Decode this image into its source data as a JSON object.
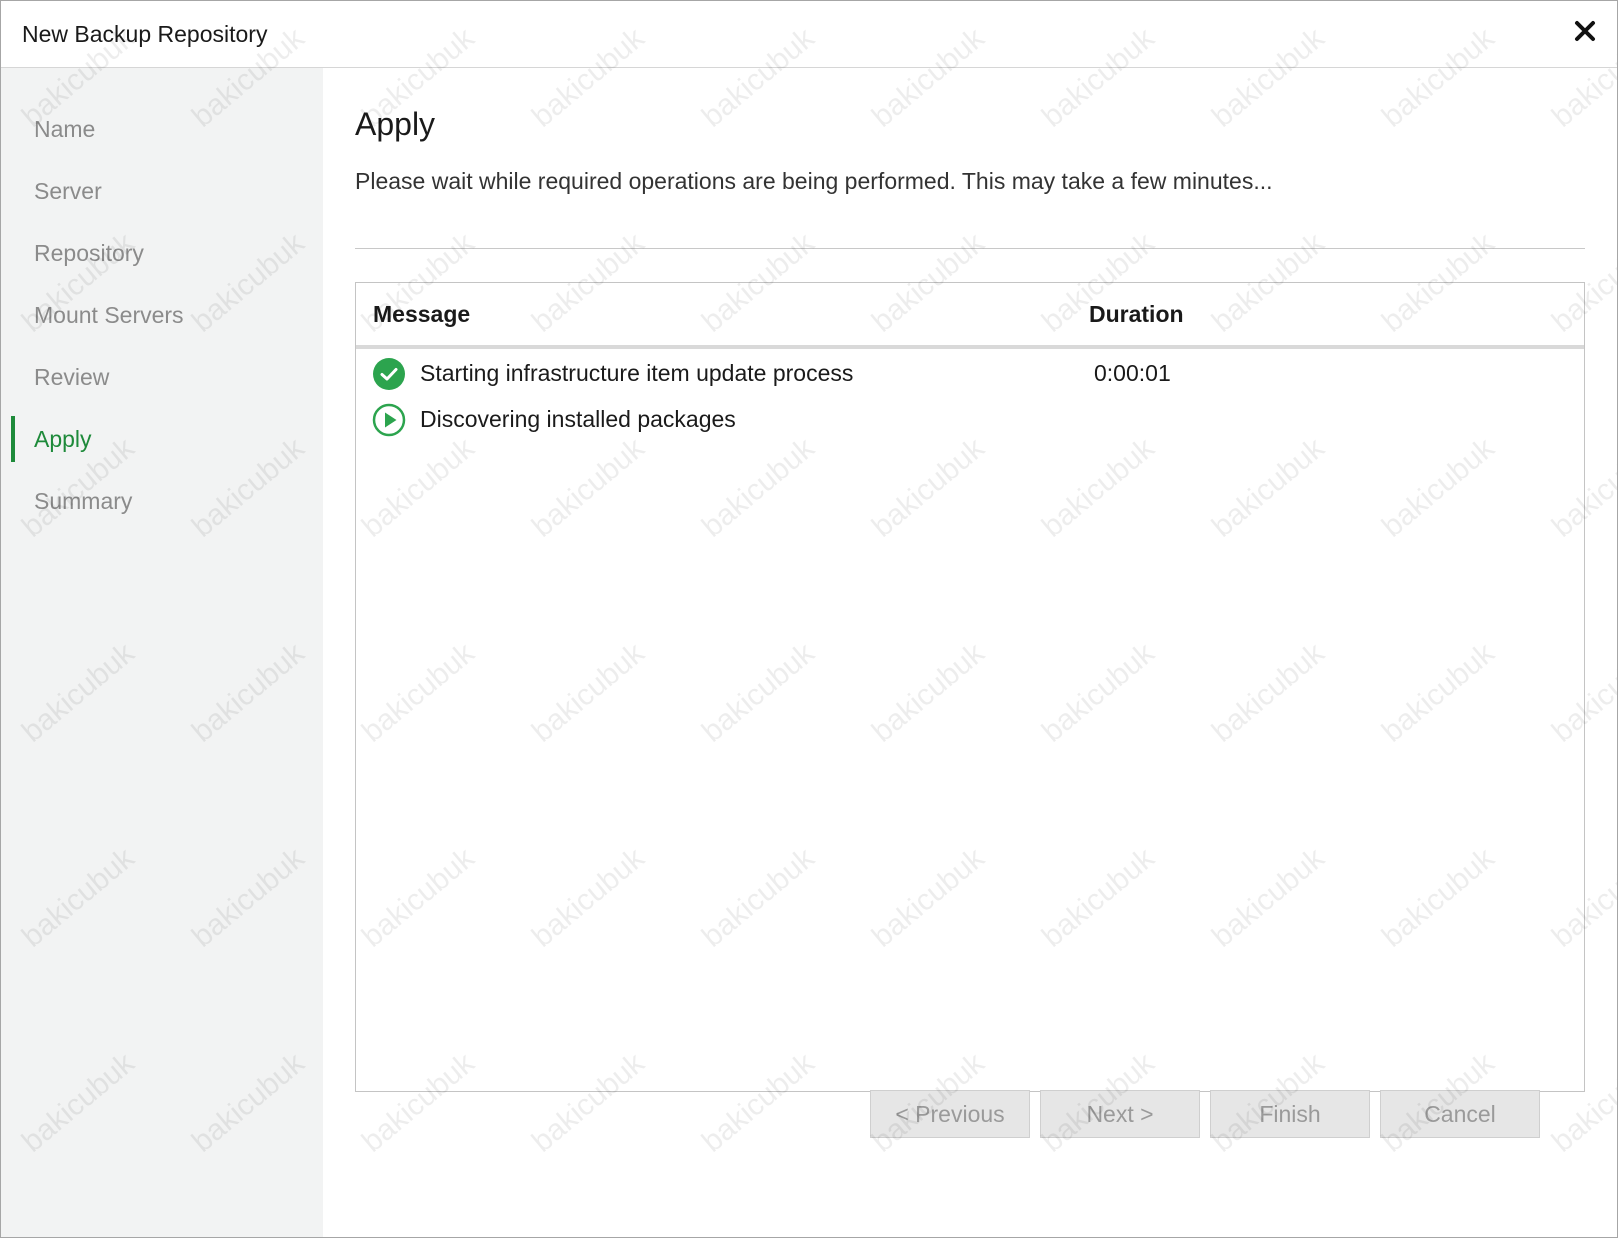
{
  "window": {
    "title": "New Backup Repository"
  },
  "sidebar": {
    "steps": [
      {
        "label": "Name"
      },
      {
        "label": "Server"
      },
      {
        "label": "Repository"
      },
      {
        "label": "Mount Servers"
      },
      {
        "label": "Review"
      },
      {
        "label": "Apply",
        "active": true
      },
      {
        "label": "Summary"
      }
    ]
  },
  "main": {
    "title": "Apply",
    "description": "Please wait while required operations are being performed. This may take a few minutes...",
    "log": {
      "columns": {
        "message": "Message",
        "duration": "Duration"
      },
      "rows": [
        {
          "status": "success",
          "icon": "check-circle-icon",
          "message": "Starting infrastructure item update process",
          "duration": "0:00:01"
        },
        {
          "status": "running",
          "icon": "play-circle-icon",
          "message": "Discovering installed packages",
          "duration": ""
        }
      ]
    }
  },
  "buttons": {
    "previous": "< Previous",
    "next": "Next >",
    "finish": "Finish",
    "cancel": "Cancel"
  },
  "watermark": {
    "text": "bakicubuk"
  },
  "colors": {
    "accent": "#1e8a3a",
    "success": "#2ca44e"
  }
}
